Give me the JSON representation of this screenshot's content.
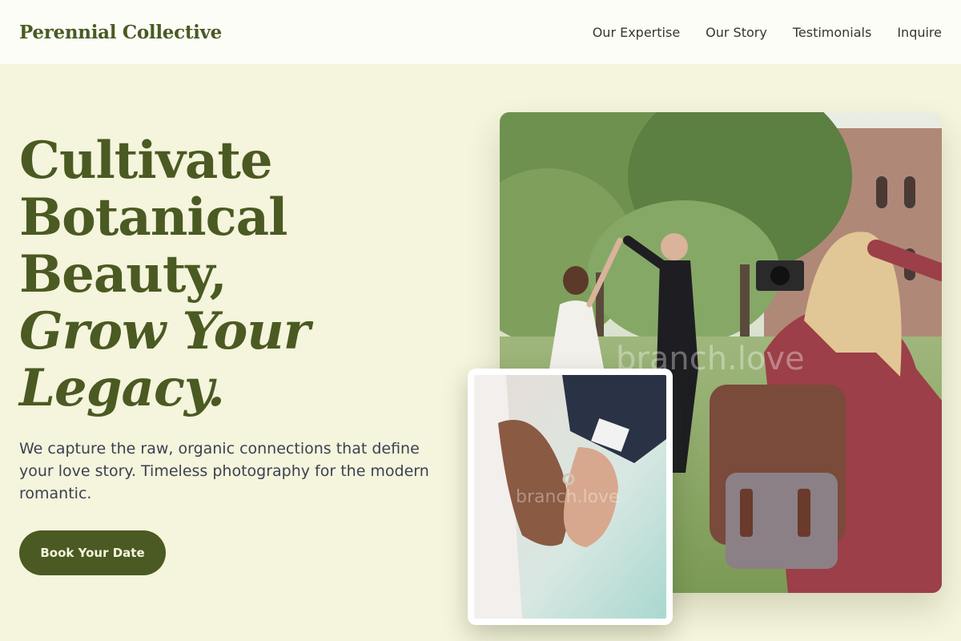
{
  "header": {
    "brand": "Perennial Collective",
    "nav": [
      {
        "label": "Our Expertise"
      },
      {
        "label": "Our Story"
      },
      {
        "label": "Testimonials"
      },
      {
        "label": "Inquire"
      }
    ]
  },
  "hero": {
    "title_lines": [
      "Cultivate",
      "Botanical",
      "Beauty,"
    ],
    "title_italic_lines": [
      "Grow Your",
      "Legacy."
    ],
    "subtitle": "We capture the raw, organic connections that define your love story. Timeless photography for the modern romantic.",
    "cta_label": "Book Your Date"
  },
  "images": {
    "main": {
      "watermark": "branch.love"
    },
    "inset": {
      "watermark": "branch.love"
    }
  },
  "colors": {
    "background": "#f5f4dc",
    "header_bg": "#fdfdf8",
    "brand_green": "#4a5a22",
    "text_dark": "#3b4252"
  }
}
